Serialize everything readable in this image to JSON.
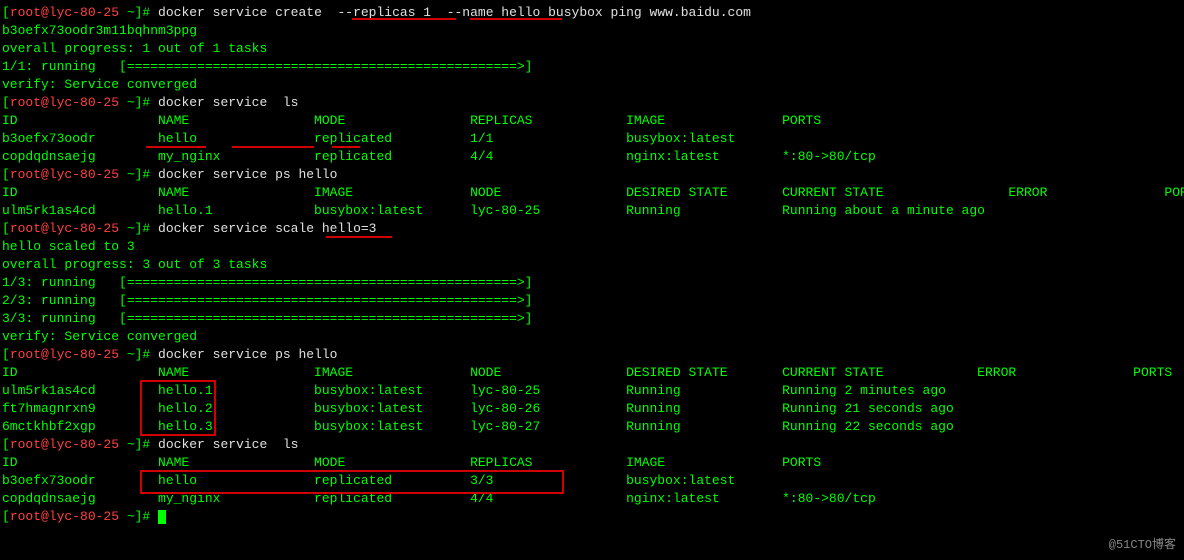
{
  "prompt": {
    "open": "[",
    "user_host": "root@lyc-80-25",
    "close": " ~]# "
  },
  "cmd1": "docker service create  --replicas 1  --name hello busybox ping www.baidu.com",
  "resp1a": "b3oefx73oodr3m11bqhnm3ppg",
  "resp1b": "overall progress: 1 out of 1 tasks",
  "resp1c": "1/1: running   [==================================================>]",
  "resp1d": "verify: Service converged",
  "cmd2": "docker service  ls",
  "ls1_header": "ID                  NAME                MODE                REPLICAS            IMAGE               PORTS",
  "ls1_row1": "b3oefx73oodr        hello               replicated          1/1                 busybox:latest      ",
  "ls1_row2": "copdqdnsaejg        my_nginx            replicated          4/4                 nginx:latest        *:80->80/tcp",
  "cmd3": "docker service ps hello",
  "ps1_header": "ID                  NAME                IMAGE               NODE                DESIRED STATE       CURRENT STATE                ERROR               PORTS",
  "ps1_row1": "ulm5rk1as4cd        hello.1             busybox:latest      lyc-80-25           Running             Running about a minute ago                       ",
  "cmd4": "docker service scale hello=3",
  "resp4a": "hello scaled to 3",
  "resp4b": "overall progress: 3 out of 3 tasks",
  "resp4c": "1/3: running   [==================================================>]",
  "resp4d": "2/3: running   [==================================================>]",
  "resp4e": "3/3: running   [==================================================>]",
  "resp4f": "verify: Service converged",
  "cmd5": "docker service ps hello",
  "ps2_header": "ID                  NAME                IMAGE               NODE                DESIRED STATE       CURRENT STATE            ERROR               PORTS",
  "ps2_row1": "ulm5rk1as4cd        hello.1             busybox:latest      lyc-80-25           Running             Running 2 minutes ago                       ",
  "ps2_row2": "ft7hmagnrxn9        hello.2             busybox:latest      lyc-80-26           Running             Running 21 seconds ago                       ",
  "ps2_row3": "6mctkhbf2xgp        hello.3             busybox:latest      lyc-80-27           Running             Running 22 seconds ago                       ",
  "cmd6": "docker service  ls",
  "ls2_header": "ID                  NAME                MODE                REPLICAS            IMAGE               PORTS",
  "ls2_row1": "b3oefx73oodr        hello               replicated          3/3                 busybox:latest      ",
  "ls2_row2": "copdqdnsaejg        my_nginx            replicated          4/4                 nginx:latest        *:80->80/tcp",
  "watermark": "@51CTO博客"
}
